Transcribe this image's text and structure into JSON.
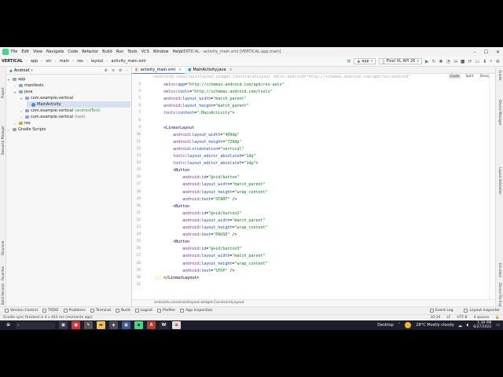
{
  "menu": {
    "items": [
      "File",
      "Edit",
      "View",
      "Navigate",
      "Code",
      "Refactor",
      "Build",
      "Run",
      "Tools",
      "VCS",
      "Window",
      "Help"
    ],
    "window_title": "VERTICAL - activity_main.xml [VERTICAL.app.main]"
  },
  "nav": {
    "crumbs": [
      "VERTICAL",
      "app",
      "src",
      "main",
      "res",
      "layout",
      "activity_main.xml"
    ],
    "run_config": "app",
    "device": "Pixel XL API 26"
  },
  "project_panel": {
    "view_mode": "Android",
    "tree": [
      {
        "label": "app",
        "level": 0
      },
      {
        "label": "manifests",
        "level": 1
      },
      {
        "label": "java",
        "level": 1
      },
      {
        "label": "com.example.vertical",
        "level": 2
      },
      {
        "label": "MainActivity",
        "level": 3
      },
      {
        "label": "com.example.vertical",
        "suffix": "(androidTest)",
        "level": 2
      },
      {
        "label": "com.example.vertical",
        "suffix": "(test)",
        "level": 2
      },
      {
        "label": "res",
        "level": 1
      },
      {
        "label": "Gradle Scripts",
        "level": 0
      }
    ]
  },
  "left_stripe": [
    "Project",
    "Resource Manager",
    "Structure",
    "Favorites",
    "Build Variants"
  ],
  "right_stripe": [
    "Gradle",
    "Device Manager",
    "Layout Validation",
    "Emulator",
    "Device File Explorer"
  ],
  "editor": {
    "tabs": [
      {
        "label": "activity_main.xml",
        "active": true
      },
      {
        "label": "MainActivity.java",
        "active": false
      }
    ],
    "view_modes": [
      "Code",
      "Split",
      "Design"
    ],
    "first_line_partial": "<androidx.constraintlayout.widget.ConstraintLayout xmlns:android=\"http://schemas.android.com/apk/res/android\"",
    "lines": [
      {
        "n": "3",
        "text": "    xmlns:app=\"http://schemas.android.com/apk/res-auto\""
      },
      {
        "n": "4",
        "text": "    xmlns:tools=\"http://schemas.android.com/tools\""
      },
      {
        "n": "5",
        "text": "    android:layout_width=\"match_parent\""
      },
      {
        "n": "6",
        "text": "    android:layout_height=\"match_parent\""
      },
      {
        "n": "7",
        "text": "    tools:context=\".MainActivity\">"
      },
      {
        "n": "8",
        "text": ""
      },
      {
        "n": "9",
        "text": "    <LinearLayout"
      },
      {
        "n": "10",
        "text": "        android:layout_width=\"409dp\""
      },
      {
        "n": "11",
        "text": "        android:layout_height=\"729dp\""
      },
      {
        "n": "12",
        "text": "        android:orientation=\"vertical\""
      },
      {
        "n": "13",
        "text": "        tools:layout_editor_absoluteX=\"1dp\""
      },
      {
        "n": "14",
        "text": "        tools:layout_editor_absoluteY=\"1dp\">"
      },
      {
        "n": "15",
        "text": "        <Button"
      },
      {
        "n": "16",
        "text": "            android:id=\"@+id/button\""
      },
      {
        "n": "17",
        "text": "            android:layout_width=\"match_parent\""
      },
      {
        "n": "18",
        "text": "            android:layout_height=\"wrap_content\""
      },
      {
        "n": "19",
        "text": "            android:text=\"START\" />"
      },
      {
        "n": "20",
        "text": "        <Button"
      },
      {
        "n": "21",
        "text": "            android:id=\"@+id/button2\""
      },
      {
        "n": "22",
        "text": "            android:layout_width=\"match_parent\""
      },
      {
        "n": "23",
        "text": "            android:layout_height=\"wrap_content\""
      },
      {
        "n": "24",
        "text": "            android:text=\"PAUSE\" />"
      },
      {
        "n": "25",
        "text": "        <Button"
      },
      {
        "n": "26",
        "text": "            android:id=\"@+id/button3\""
      },
      {
        "n": "27",
        "text": "            android:layout_width=\"match_parent\""
      },
      {
        "n": "28",
        "text": "            android:layout_height=\"wrap_content\""
      },
      {
        "n": "29",
        "text": "            android:text=\"STOP\" />"
      },
      {
        "n": "30",
        "text": "    </LinearLayout>"
      },
      {
        "n": "31",
        "text": ""
      }
    ],
    "breadcrumb": "androidx.constraintlayout.widget.ConstraintLayout"
  },
  "bottom_tools": [
    "Version Control",
    "TODO",
    "Problems",
    "Terminal",
    "Build",
    "Logcat",
    "Profiler",
    "App Inspection"
  ],
  "bottom_tools_right": [
    "Event Log",
    "Layout Inspector"
  ],
  "status": {
    "message": "Gradle sync finished in 4 s 443 ms (moments ago)",
    "position": "30:20",
    "line_sep": "LF",
    "encoding": "UTF-8",
    "indent": "4 spaces"
  },
  "taskbar": {
    "desktop": "Desktop",
    "weather": "28°C  Mostly cloudy",
    "time": "1:39 PM",
    "date": "6/27/2022"
  }
}
